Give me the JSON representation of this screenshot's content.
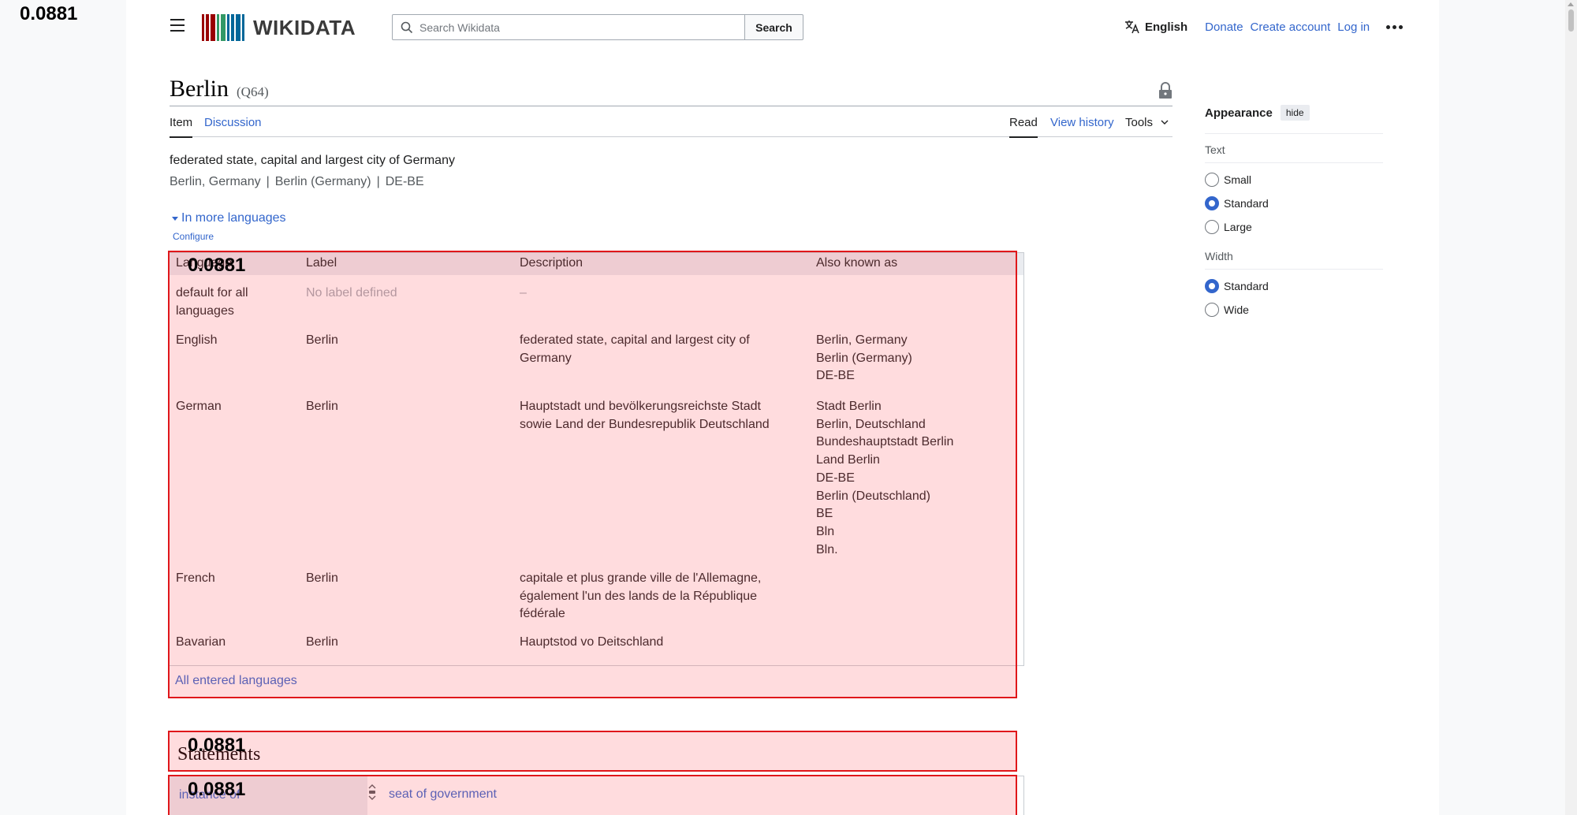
{
  "overlay": {
    "score": "0.0881"
  },
  "header": {
    "logo_text": "WIKIDATA",
    "search_placeholder": "Search Wikidata",
    "search_button": "Search",
    "language": "English",
    "links": [
      "Donate",
      "Create account",
      "Log in"
    ]
  },
  "item": {
    "title": "Berlin",
    "qid": "(Q64)",
    "tabs": {
      "item": "Item",
      "discussion": "Discussion",
      "read": "Read",
      "view_history": "View history",
      "tools": "Tools"
    },
    "description": "federated state, capital and largest city of Germany",
    "aliases": [
      "Berlin, Germany",
      "Berlin (Germany)",
      "DE-BE"
    ],
    "alias_separator": "|",
    "more_languages": "In more languages",
    "configure": "Configure"
  },
  "languages_table": {
    "headers": [
      "Language",
      "Label",
      "Description",
      "Also known as"
    ],
    "rows": [
      {
        "language": "default for all\nlanguages",
        "label": "No label defined",
        "description": "–",
        "aliases": ""
      },
      {
        "language": "English",
        "label": "Berlin",
        "description": "federated state, capital and largest city of\nGermany",
        "aliases": "Berlin, Germany\nBerlin (Germany)\nDE-BE"
      },
      {
        "language": "German",
        "label": "Berlin",
        "description": "Hauptstadt und bevölkerungsreichste Stadt\nsowie Land der Bundesrepublik Deutschland",
        "aliases": "Stadt Berlin\nBerlin, Deutschland\nBundeshauptstadt Berlin\nLand Berlin\nDE-BE\nBerlin (Deutschland)\nBE\nBln\nBln."
      },
      {
        "language": "French",
        "label": "Berlin",
        "description": "capitale et plus grande ville de l'Allemagne,\négalement l'un des lands de la République\nfédérale",
        "aliases": ""
      },
      {
        "language": "Bavarian",
        "label": "Berlin",
        "description": "Hauptstod vo Deitschland",
        "aliases": ""
      }
    ],
    "all_languages": "All entered languages"
  },
  "statements": {
    "title": "Statements",
    "first_property": "instance of",
    "first_value": "seat of government"
  },
  "appearance": {
    "title": "Appearance",
    "hide": "hide",
    "text_label": "Text",
    "text_options": [
      "Small",
      "Standard",
      "Large"
    ],
    "text_selected": "Standard",
    "width_label": "Width",
    "width_options": [
      "Standard",
      "Wide"
    ],
    "width_selected": "Standard"
  },
  "colors": {
    "link": "#3366cc",
    "highlight_border": "#e0171b"
  }
}
